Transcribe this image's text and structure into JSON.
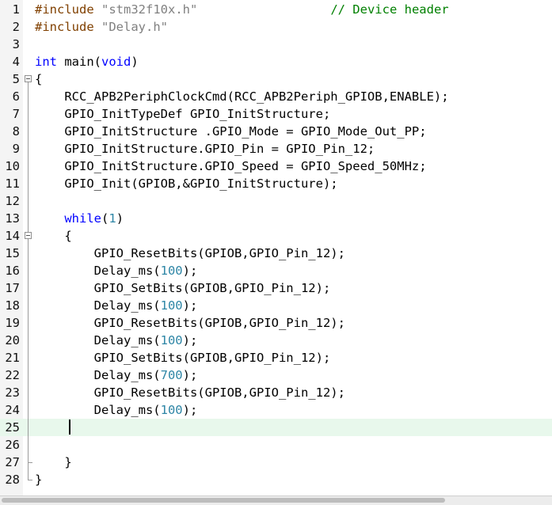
{
  "editor": {
    "current_line": 25,
    "lines": [
      {
        "n": "1",
        "tokens": [
          [
            "pp",
            "#include "
          ],
          [
            "str",
            "\"stm32f10x.h\""
          ],
          [
            "plain",
            "                  "
          ],
          [
            "cmt",
            "// Device header"
          ]
        ]
      },
      {
        "n": "2",
        "tokens": [
          [
            "pp",
            "#include "
          ],
          [
            "str",
            "\"Delay.h\""
          ]
        ]
      },
      {
        "n": "3",
        "tokens": []
      },
      {
        "n": "4",
        "tokens": [
          [
            "kw",
            "int"
          ],
          [
            "plain",
            " main("
          ],
          [
            "kw",
            "void"
          ],
          [
            "plain",
            ")"
          ]
        ]
      },
      {
        "n": "5",
        "tokens": [
          [
            "plain",
            "{"
          ]
        ]
      },
      {
        "n": "6",
        "tokens": [
          [
            "plain",
            "    RCC_APB2PeriphClockCmd(RCC_APB2Periph_GPIOB,ENABLE);"
          ]
        ]
      },
      {
        "n": "7",
        "tokens": [
          [
            "plain",
            "    GPIO_InitTypeDef GPIO_InitStructure;"
          ]
        ]
      },
      {
        "n": "8",
        "tokens": [
          [
            "plain",
            "    GPIO_InitStructure .GPIO_Mode = GPIO_Mode_Out_PP;"
          ]
        ]
      },
      {
        "n": "9",
        "tokens": [
          [
            "plain",
            "    GPIO_InitStructure.GPIO_Pin = GPIO_Pin_12;"
          ]
        ]
      },
      {
        "n": "10",
        "tokens": [
          [
            "plain",
            "    GPIO_InitStructure.GPIO_Speed = GPIO_Speed_50MHz;"
          ]
        ]
      },
      {
        "n": "11",
        "tokens": [
          [
            "plain",
            "    GPIO_Init(GPIOB,&GPIO_InitStructure);"
          ]
        ]
      },
      {
        "n": "12",
        "tokens": []
      },
      {
        "n": "13",
        "tokens": [
          [
            "plain",
            "    "
          ],
          [
            "kw",
            "while"
          ],
          [
            "plain",
            "("
          ],
          [
            "num",
            "1"
          ],
          [
            "plain",
            ")"
          ]
        ]
      },
      {
        "n": "14",
        "tokens": [
          [
            "plain",
            "    {"
          ]
        ]
      },
      {
        "n": "15",
        "tokens": [
          [
            "plain",
            "        GPIO_ResetBits(GPIOB,GPIO_Pin_12);"
          ]
        ]
      },
      {
        "n": "16",
        "tokens": [
          [
            "plain",
            "        Delay_ms("
          ],
          [
            "num",
            "100"
          ],
          [
            "plain",
            ");"
          ]
        ]
      },
      {
        "n": "17",
        "tokens": [
          [
            "plain",
            "        GPIO_SetBits(GPIOB,GPIO_Pin_12);"
          ]
        ]
      },
      {
        "n": "18",
        "tokens": [
          [
            "plain",
            "        Delay_ms("
          ],
          [
            "num",
            "100"
          ],
          [
            "plain",
            ");"
          ]
        ]
      },
      {
        "n": "19",
        "tokens": [
          [
            "plain",
            "        GPIO_ResetBits(GPIOB,GPIO_Pin_12);"
          ]
        ]
      },
      {
        "n": "20",
        "tokens": [
          [
            "plain",
            "        Delay_ms("
          ],
          [
            "num",
            "100"
          ],
          [
            "plain",
            ");"
          ]
        ]
      },
      {
        "n": "21",
        "tokens": [
          [
            "plain",
            "        GPIO_SetBits(GPIOB,GPIO_Pin_12);"
          ]
        ]
      },
      {
        "n": "22",
        "tokens": [
          [
            "plain",
            "        Delay_ms("
          ],
          [
            "num",
            "700"
          ],
          [
            "plain",
            ");"
          ]
        ]
      },
      {
        "n": "23",
        "tokens": [
          [
            "plain",
            "        GPIO_ResetBits(GPIOB,GPIO_Pin_12);"
          ]
        ]
      },
      {
        "n": "24",
        "tokens": [
          [
            "plain",
            "        Delay_ms("
          ],
          [
            "num",
            "100"
          ],
          [
            "plain",
            ");"
          ]
        ]
      },
      {
        "n": "25",
        "tokens": []
      },
      {
        "n": "26",
        "tokens": []
      },
      {
        "n": "27",
        "tokens": [
          [
            "plain",
            "    }"
          ]
        ]
      },
      {
        "n": "28",
        "tokens": [
          [
            "plain",
            "}"
          ]
        ]
      }
    ]
  },
  "colors": {
    "keyword": "#0000ff",
    "preprocessor": "#804000",
    "string": "#808080",
    "comment": "#008000",
    "number": "#2e86a6",
    "current_line": "#e8f8ec"
  }
}
